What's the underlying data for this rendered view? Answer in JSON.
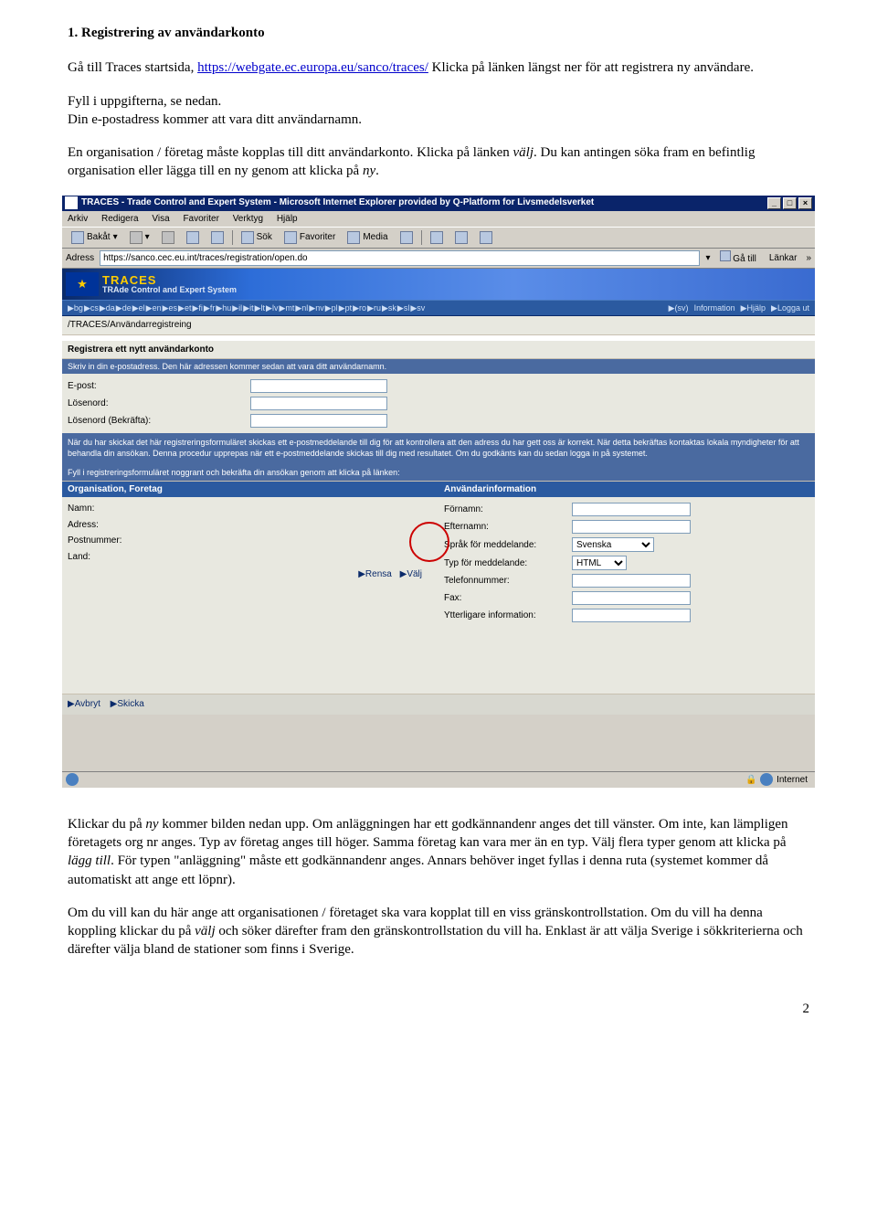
{
  "doc": {
    "heading": "1. Registrering av användarkonto",
    "p1a": "Gå till Traces startsida, ",
    "link": "https://webgate.ec.europa.eu/sanco/traces/",
    "p1b": " Klicka på länken längst ner för att registrera ny användare.",
    "p2a": "Fyll i uppgifterna, se nedan.",
    "p2b": "Din e-postadress kommer att vara ditt användarnamn.",
    "p3a": "En organisation / företag måste kopplas till ditt användarkonto. Klicka på länken ",
    "p3i1": "välj",
    "p3b": ". Du kan antingen söka fram en befintlig organisation eller lägga till en ny genom att klicka på ",
    "p3i2": "ny",
    "p3c": ".",
    "p4a": "Klickar du på ",
    "p4i1": "ny",
    "p4b": " kommer bilden nedan upp. Om anläggningen har ett godkännandenr anges det till vänster. Om inte, kan lämpligen företagets org nr anges. Typ av företag anges till höger. Samma företag kan vara mer än en typ. Välj flera typer genom att klicka på ",
    "p4i2": "lägg till",
    "p4c": ". För typen \"anläggning\" måste ett godkännandenr anges. Annars behöver inget fyllas i denna ruta (systemet kommer då automatiskt att ange ett löpnr).",
    "p5a": "Om du vill kan du här ange att organisationen / företaget ska vara kopplat till en viss gränskontrollstation. Om du vill ha denna koppling klickar du på ",
    "p5i1": "välj",
    "p5b": " och söker därefter fram den gränskontrollstation du vill ha. Enklast är att välja Sverige i sökkriterierna och därefter välja bland de stationer som finns i Sverige.",
    "pagenum": "2"
  },
  "shot": {
    "title": "TRACES - Trade Control and Expert System - Microsoft Internet Explorer provided by Q-Platform for Livsmedelsverket",
    "menu": {
      "arkiv": "Arkiv",
      "redigera": "Redigera",
      "visa": "Visa",
      "favoriter": "Favoriter",
      "verktyg": "Verktyg",
      "hjalp": "Hjälp"
    },
    "tool": {
      "back": "Bakåt",
      "sok": "Sök",
      "fav": "Favoriter",
      "media": "Media"
    },
    "addr_label": "Adress",
    "addr_value": "https://sanco.cec.eu.int/traces/registration/open.do",
    "go": "Gå till",
    "links": "Länkar",
    "brand1": "TRACES",
    "brand2": "TRAde Control and Expert System",
    "langs": [
      "▶bg",
      "▶cs",
      "▶da",
      "▶de",
      "▶el",
      "▶en",
      "▶es",
      "▶et",
      "▶fi",
      "▶fr",
      "▶hu",
      "▶il",
      "▶it",
      "▶lt",
      "▶lv",
      "▶mt",
      "▶nl",
      "▶nv",
      "▶pl",
      "▶pt",
      "▶ro",
      "▶ru",
      "▶sk",
      "▶sl",
      "▶sv"
    ],
    "rmenu": {
      "sv": "▶(sv)",
      "info": "Information",
      "help": "▶Hjälp",
      "logga": "▶Logga ut"
    },
    "breadcrumb": "/TRACES/Användarregistreing",
    "panel_title": "Registrera ett nytt användarkonto",
    "panel_sub": "Skriv in din e-postadress. Den här adressen kommer sedan att vara ditt användarnamn.",
    "f_email": "E-post:",
    "f_pw": "Lösenord:",
    "f_pw2": "Lösenord (Bekräfta):",
    "info1": "När du har skickat det här registreringsformuläret skickas ett e-postmeddelande till dig för att kontrollera att den adress du har gett oss är korrekt. När detta bekräftas kontaktas lokala myndigheter för att behandla din ansökan. Denna procedur upprepas när ett e-postmeddelande skickas till dig med resultatet. Om du godkänts kan du sedan logga in på systemet.",
    "info2": "Fyll i registreringsformuläret noggrant och bekräfta din ansökan genom att klicka på länken:",
    "colL": "Organisation, Foretag",
    "colR": "Användarinformation",
    "l_namn": "Namn:",
    "l_adr": "Adress:",
    "l_post": "Postnummer:",
    "l_land": "Land:",
    "l_rensa": "▶Rensa",
    "l_valj": "▶Välj",
    "r_for": "Förnamn:",
    "r_eft": "Efternamn:",
    "r_spr": "Språk för meddelande:",
    "r_typ": "Typ för meddelande:",
    "r_tel": "Telefonnummer:",
    "r_fax": "Fax:",
    "r_ytt": "Ytterligare information:",
    "sel_sprak": "Svenska",
    "sel_typ": "HTML",
    "avbryt": "▶Avbryt",
    "skicka": "▶Skicka",
    "status_zone": "Internet"
  }
}
